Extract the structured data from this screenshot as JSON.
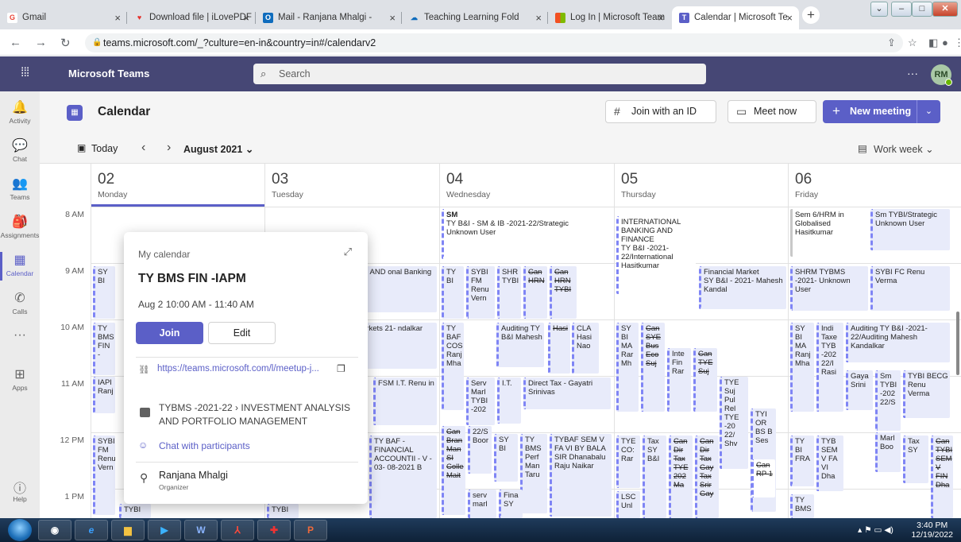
{
  "browser": {
    "tabs": [
      {
        "title": "Gmail",
        "icon": "gmail-icon",
        "color": "#ea4335",
        "glyph": "G"
      },
      {
        "title": "Download file | iLovePDF",
        "icon": "heart-icon",
        "color": "#e5322d",
        "glyph": "♥"
      },
      {
        "title": "Mail - Ranjana Mhalgi -",
        "icon": "outlook-icon",
        "color": "#0f6cbd",
        "glyph": "O"
      },
      {
        "title": "Teaching Learning Fold",
        "icon": "onedrive-icon",
        "color": "#0f6cbd",
        "glyph": "☁"
      },
      {
        "title": "Log In | Microsoft Team",
        "icon": "microsoft-icon",
        "color": "#f25022",
        "glyph": "■"
      },
      {
        "title": "Calendar | Microsoft Te",
        "icon": "teams-icon",
        "color": "#5b5fc7",
        "glyph": "T"
      }
    ],
    "url": "teams.microsoft.com/_?culture=en-in&country=in#/calendarv2"
  },
  "teams": {
    "app_name": "Microsoft Teams",
    "search_placeholder": "Search",
    "avatar_initials": "RM"
  },
  "rail": [
    {
      "label": "Activity",
      "icon": "bell-icon",
      "glyph": "🔔"
    },
    {
      "label": "Chat",
      "icon": "chat-icon",
      "glyph": "💬"
    },
    {
      "label": "Teams",
      "icon": "teams-group-icon",
      "glyph": "👥"
    },
    {
      "label": "Assignments",
      "icon": "assignments-icon",
      "glyph": "🎒"
    },
    {
      "label": "Calendar",
      "icon": "calendar-icon",
      "glyph": "▦",
      "active": true
    },
    {
      "label": "Calls",
      "icon": "phone-icon",
      "glyph": "✆"
    },
    {
      "label": "",
      "icon": "more-icon",
      "glyph": "···"
    },
    {
      "label": "Apps",
      "icon": "apps-icon",
      "glyph": "⊞"
    },
    {
      "label": "Help",
      "icon": "help-icon",
      "glyph": "?"
    }
  ],
  "calendar": {
    "title": "Calendar",
    "join_id": "Join with an ID",
    "meet_now": "Meet now",
    "new_meeting": "New meeting",
    "today": "Today",
    "month": "August 2021",
    "view": "Work week",
    "days": [
      {
        "num": "02",
        "name": "Monday"
      },
      {
        "num": "03",
        "name": "Tuesday"
      },
      {
        "num": "04",
        "name": "Wednesday"
      },
      {
        "num": "05",
        "name": "Thursday"
      },
      {
        "num": "06",
        "name": "Friday"
      }
    ],
    "hours": [
      "8 AM",
      "9 AM",
      "10 AM",
      "11 AM",
      "12 PM",
      "1 PM"
    ]
  },
  "events": {
    "mon": [
      "SY BI",
      "TY BMS FIN -",
      "IAPI Ranj",
      "SYBI FM Renu Vern",
      "TYBI"
    ],
    "tue": [
      "G AND onal Banking",
      "arkets 21- ndalkar",
      "FSM I.T. Renu in",
      "TY BAF - FINANCIAL ACCOUNTII - V - 03- 08-2021 B",
      "TYBI"
    ],
    "wed_sm": "SM",
    "wed_sm_sub": "TY B&I - SM & IB -2021-22/Strategic",
    "wed_sm_user": "Unknown User",
    "wed": [
      "TY BI",
      "SYBI FM Renu Vern",
      "SHR TYBI",
      "Can HRN",
      "Can HRN TYBI",
      "TY BAF COS Ranj Mha",
      "Auditing TY B&I Mahesh",
      "CLA Hasi Nao",
      "Hasi",
      "Serv Marl TYBI -202",
      "I.T.",
      "Direct Tax - Gayatri Srinivas",
      "Can Bran Man SI Colle Mait",
      "22/S Boor",
      "SY BI",
      "TY BMS Perf Man Taru",
      "TYBAF SEM V FA VI BY BALA SIR Dhanabalu Raju Naikar",
      "serv marl",
      "Fina SY"
    ],
    "thu_intl": "INTERNATIONAL BANKING AND FINANCE",
    "thu_intl_sub": "TY B&I -2021-22/International Hasitkumar",
    "thu_fm": "Financial Market",
    "thu_fm_sub": "SY B&I - 2021- Mahesh Kandal",
    "thu": [
      "SY BI MA Rar Mh",
      "Can SYE Bus Eco Suj",
      "Inte Fin Rar",
      "Can TYE Suj",
      "TYE Suj Pul Rel TYE -20 22/ Shv",
      "TYI OR BS B Ses",
      "TYE CO: Rar",
      "Tax SY B&I",
      "Can Dir Tax TYE 202 Ma",
      "Can Dir Tax Gay Tax Srir Gay",
      "Can RP 1",
      "LSC Unl"
    ],
    "fri_sem6": "Sem 6/HRM in Globalised Hasitkumar",
    "fri_sm": "Sm TYBI/Strategic Unknown User",
    "fri_shrm": "SHRM TYBMS -2021- Unknown User",
    "fri_sybi": "SYBI FC Renu Verma",
    "fri": [
      "SY BI MA Ranj Mha",
      "Indi Taxe TYB -202 22/I Rasi",
      "Auditing TY B&I -2021-22/Auditing Mahesh Kandalkar",
      "Gaya Srini",
      "Sm TYBI -202 22/S",
      "TYBI BECG Renu Verma",
      "TY BI FRA",
      "TYB SEM V FA VI Dha",
      "Marl Boo",
      "Tax SY",
      "Can TYBI SEM V FIN Dha",
      "TY BMS"
    ]
  },
  "popup": {
    "calendar_label": "My calendar",
    "title": "TY BMS FIN -IAPM",
    "time": "Aug 2 10:00 AM - 11:40 AM",
    "join": "Join",
    "edit": "Edit",
    "link": "https://teams.microsoft.com/l/meetup-j...",
    "channel": "TYBMS -2021-22  ›  INVESTMENT ANALYSIS AND PORTFOLIO MANAGEMENT",
    "chat": "Chat with participants",
    "organizer": "Ranjana Mhalgi",
    "organizer_role": "Organizer"
  },
  "taskbar": {
    "time": "3:40 PM",
    "date": "12/19/2022"
  }
}
